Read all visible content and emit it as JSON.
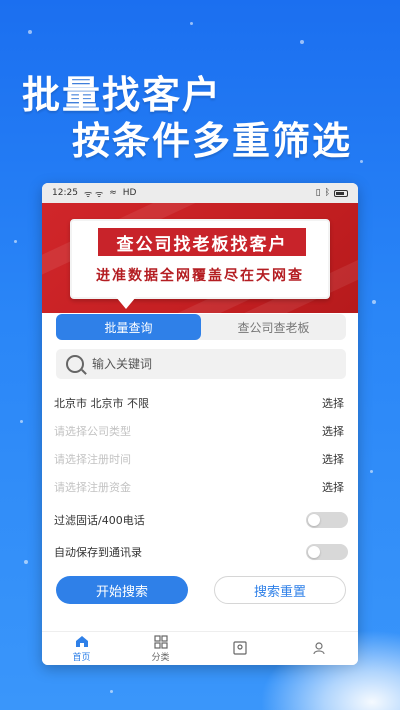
{
  "headline": {
    "line1": "批量找客户",
    "line2": "按条件多重筛选"
  },
  "status_bar": {
    "time": "12:25",
    "signal": "ᯤ ᯤ",
    "hd": "HD"
  },
  "banner": {
    "title": "查公司找老板找客户",
    "subtitle": "进准数据全网覆盖尽在天网查"
  },
  "tabs": [
    {
      "label": "批量查询"
    },
    {
      "label": "查公司查老板"
    }
  ],
  "search": {
    "placeholder": "输入关键词",
    "value": ""
  },
  "filters": [
    {
      "value": "北京市  北京市  不限",
      "action": "选择"
    },
    {
      "placeholder": "请选择公司类型",
      "action": "选择"
    },
    {
      "placeholder": "请选择注册时间",
      "action": "选择"
    },
    {
      "placeholder": "请选择注册资金",
      "action": "选择"
    }
  ],
  "toggles": [
    {
      "label": "过滤固话/400电话",
      "on": false
    },
    {
      "label": "自动保存到通讯录",
      "on": false
    }
  ],
  "buttons": {
    "start": "开始搜索",
    "reset": "搜索重置"
  },
  "nav": [
    {
      "label": "首页",
      "icon": "home-icon"
    },
    {
      "label": "分类",
      "icon": "grid-icon"
    },
    {
      "label": "",
      "icon": "contact-card-icon"
    },
    {
      "label": "",
      "icon": "user-icon"
    }
  ],
  "colors": {
    "background_blue": "#1b6ff0",
    "accent_blue": "#2f80e8",
    "banner_red": "#c8232a"
  }
}
